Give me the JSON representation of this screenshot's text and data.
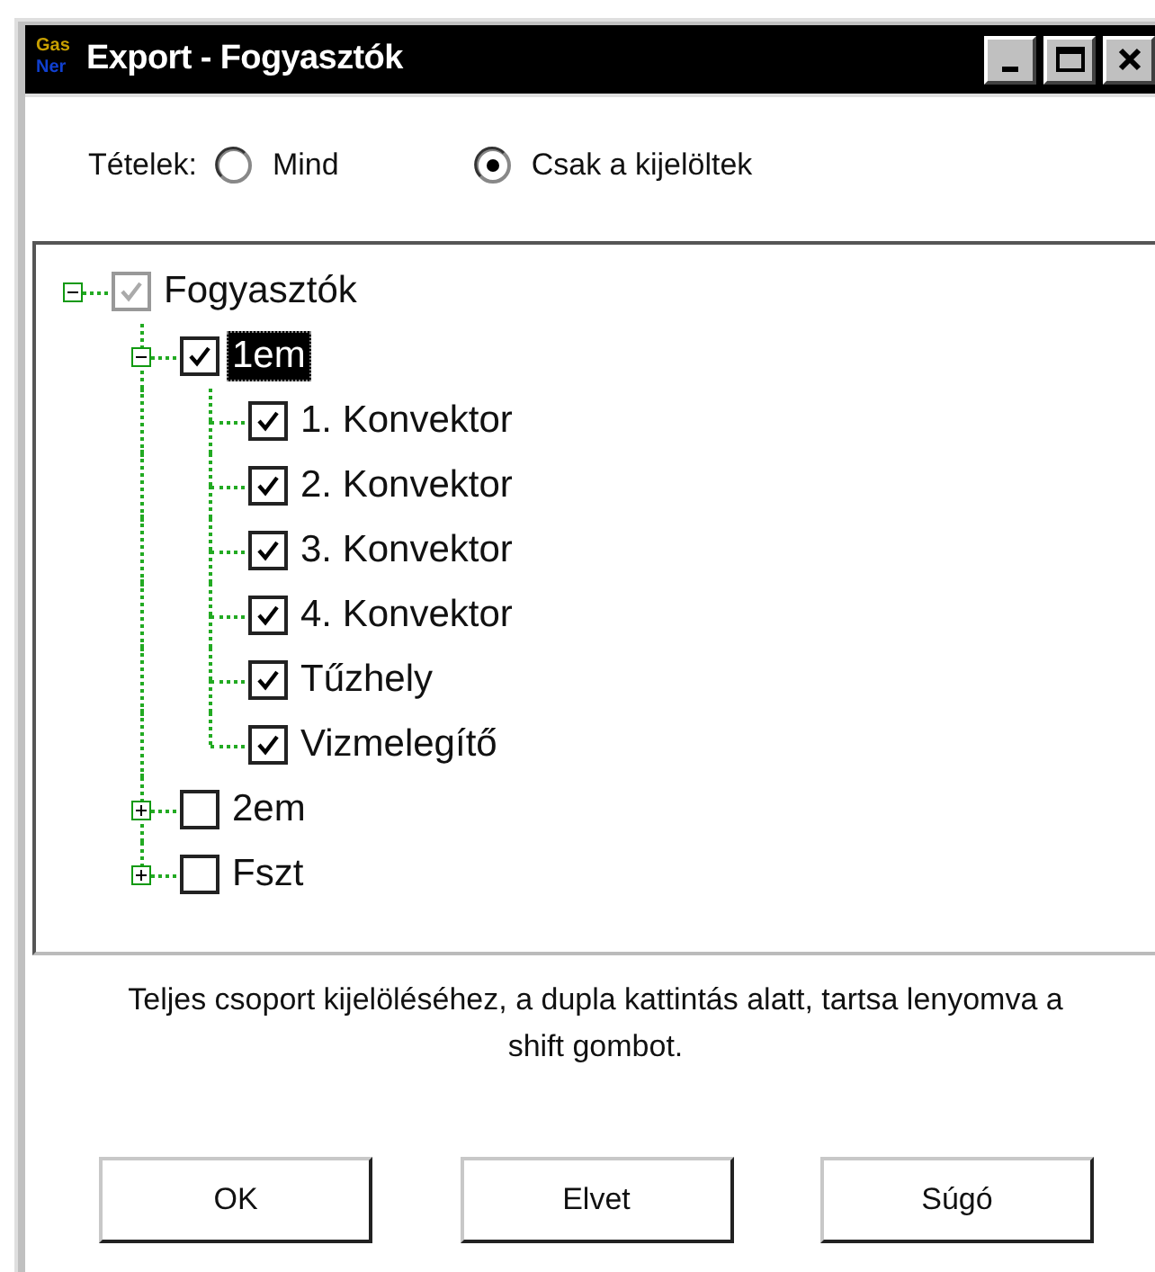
{
  "window": {
    "title": "Export - Fogyasztók",
    "app_icon": {
      "top": "Gas",
      "bottom": "Ner"
    }
  },
  "items_choice": {
    "label": "Tételek:",
    "options": [
      {
        "label": "Mind",
        "selected": false
      },
      {
        "label": "Csak a kijelöltek",
        "selected": true
      }
    ]
  },
  "tree": {
    "items": [
      {
        "label": "Fogyasztók",
        "checked": true,
        "grayed": true,
        "selected": false,
        "expanded": true,
        "children": [
          {
            "label": "1em",
            "checked": true,
            "grayed": false,
            "selected": true,
            "expanded": true,
            "children": [
              {
                "label": "1. Konvektor",
                "checked": true,
                "grayed": false,
                "selected": false
              },
              {
                "label": "2. Konvektor",
                "checked": true,
                "grayed": false,
                "selected": false
              },
              {
                "label": "3. Konvektor",
                "checked": true,
                "grayed": false,
                "selected": false
              },
              {
                "label": "4. Konvektor",
                "checked": true,
                "grayed": false,
                "selected": false
              },
              {
                "label": "Tűzhely",
                "checked": true,
                "grayed": false,
                "selected": false
              },
              {
                "label": "Vizmelegítő",
                "checked": true,
                "grayed": false,
                "selected": false
              }
            ]
          },
          {
            "label": "2em",
            "checked": false,
            "grayed": false,
            "selected": false,
            "expanded": false
          },
          {
            "label": "Fszt",
            "checked": false,
            "grayed": false,
            "selected": false,
            "expanded": false
          }
        ]
      }
    ]
  },
  "hint": "Teljes csoport kijelöléséhez, a dupla kattintás alatt, tartsa lenyomva a shift gombot.",
  "buttons": [
    "OK",
    "Elvet",
    "Súgó"
  ]
}
